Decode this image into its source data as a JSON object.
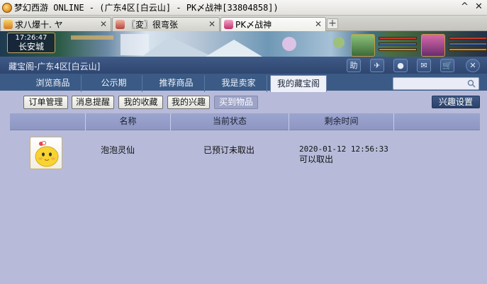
{
  "window": {
    "title": "梦幻西游 ONLINE - (广东4区[白云山] - PK〆战神[33804858])",
    "minimize_glyph": "^",
    "close_glyph": "✕"
  },
  "tabs": [
    {
      "label": "求八爆十. ヤ",
      "close": "✕"
    },
    {
      "label": "〖変〗很弯张",
      "close": "✕"
    },
    {
      "label": "PK〆战神",
      "close": "✕"
    }
  ],
  "tab_new": "+",
  "hud": {
    "time": "17:26:47",
    "city": "长安城"
  },
  "panel": {
    "title": "藏宝阁-广东4区[白云山]",
    "header_buttons": [
      {
        "name": "help",
        "label": "助"
      },
      {
        "name": "share",
        "label": "✈"
      },
      {
        "name": "record",
        "label": "●"
      },
      {
        "name": "message",
        "label": "✉"
      },
      {
        "name": "cart",
        "label": "🛒"
      },
      {
        "name": "close",
        "label": "✕"
      }
    ]
  },
  "nav": {
    "tabs": [
      "浏览商品",
      "公示期",
      "推荐商品",
      "我是卖家",
      "我的藏宝阁"
    ],
    "active_index": 4,
    "search_placeholder": ""
  },
  "subnav": {
    "buttons": [
      "订单管理",
      "消息提醒",
      "我的收藏",
      "我的兴趣",
      "买到物品"
    ],
    "active_index": 4,
    "interest_settings": "兴趣设置"
  },
  "table": {
    "columns": [
      "名称",
      "当前状态",
      "剩余时间"
    ],
    "rows": [
      {
        "icon": "bubble-spirit-icon",
        "name": "泡泡灵仙",
        "status": "已预订未取出",
        "time": "2020-01-12 12:56:33",
        "time_note": "可以取出"
      }
    ]
  },
  "colors": {
    "panel_bg": "#b7bbd9",
    "header_bg": "#2e4670",
    "table_header": "#9ca5cf"
  }
}
